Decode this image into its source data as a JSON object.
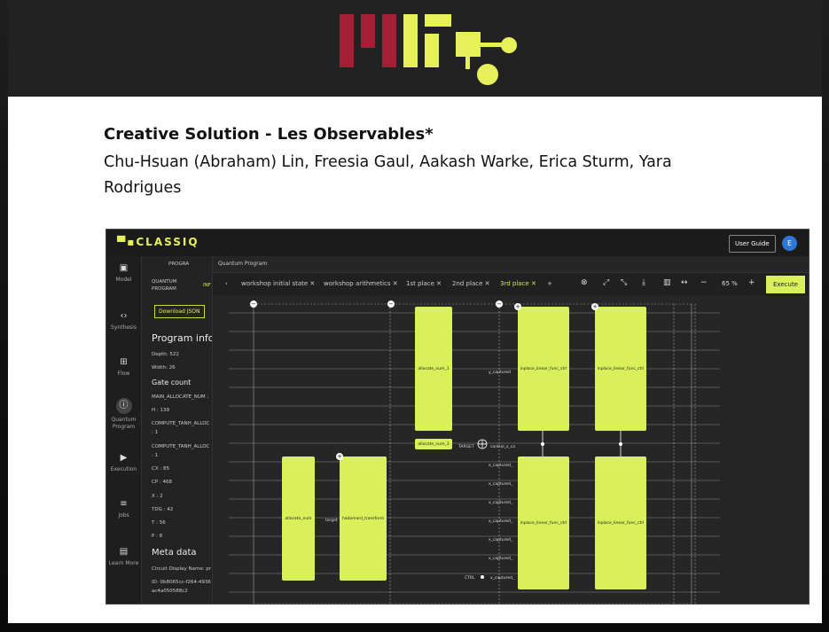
{
  "slide": {
    "title": "Creative Solution - Les Observables*",
    "authors_line1": "Chu-Hsuan (Abraham) Lin, Freesia Gaul, Aakash Warke, Erica Sturm, Yara",
    "authors_line2": "Rodrigues"
  },
  "colors": {
    "mit_red": "#a31f34",
    "mit_green": "#e6f15a",
    "banner": "#222222",
    "accent": "#d9f05a",
    "avatar": "#2d78d6"
  },
  "app": {
    "logo": "CLASSIQ",
    "user_guide": "User Guide",
    "avatar_letter": "E",
    "nav": [
      {
        "icon": "model-icon",
        "label": "Model",
        "glyph": "▣"
      },
      {
        "icon": "synthesis-icon",
        "label": "Synthesis",
        "glyph": "‹›"
      },
      {
        "icon": "flow-icon",
        "label": "Flow",
        "glyph": "⊞"
      },
      {
        "icon": "quantum-program-icon",
        "label": "Quantum Program",
        "glyph": "ⓘ"
      },
      {
        "icon": "execution-icon",
        "label": "Execution",
        "glyph": "▶"
      },
      {
        "icon": "jobs-icon",
        "label": "Jobs",
        "glyph": "≡"
      },
      {
        "icon": "learn-more-icon",
        "label": "Learn More",
        "glyph": "▤"
      }
    ],
    "panel": {
      "crumb": "PROGRA",
      "tab_quantum": "QUANTUM PROGRAM",
      "tab_info": "INF",
      "download": "Download JSON",
      "heading": "Program info",
      "depth": "Depth: 522",
      "width": "Width: 26",
      "gate_count": "Gate count",
      "main_alloc": "MAIN_ALLOCATE_NUM :",
      "h": "H : 139",
      "compute1": "COMPUTE_TANH_ALLOC",
      "compute1_v": ": 1",
      "compute2": "COMPUTE_TANH_ALLOC",
      "compute2_v": ": 1",
      "cx": "CX : 85",
      "cp": "CP : 468",
      "x": "X : 2",
      "tdg": "TDG : 42",
      "t": "T : 56",
      "p": "P : 8",
      "meta": "Meta data",
      "circuit_name": "Circuit Display Name: pr",
      "id1": "ID: 0b8065cc-f264-4936",
      "id2": "ac4a050588c2"
    },
    "breadcrumb": "Quantum Program",
    "tabs": [
      "workshop initial state",
      "workshop arithmetics",
      "1st place",
      "2nd place",
      "3rd place"
    ],
    "active_tab": "3rd place",
    "zoom": "65 %",
    "execute": "Execute",
    "circuit": {
      "gate_allocate_num_1": "allocate_num_1",
      "gate_allocate_num_3": "allocate_num_3",
      "gate_allocate_num": "allocate_num",
      "gate_hadamard": "hadamard_transform",
      "gate_inplace1": "inplace_linear_func_ctrl",
      "gate_inplace2": "inplace_linear_func_ctrl",
      "gate_inplace3": "inplace_linear_func_ctrl",
      "gate_inplace4": "inplace_linear_func_ctrl",
      "y_captured": "y_captured",
      "target": "TARGET",
      "control": "control_x_ca",
      "x_captured": "x_captured_",
      "target_small": "target",
      "ctrl": "CTRL"
    }
  }
}
